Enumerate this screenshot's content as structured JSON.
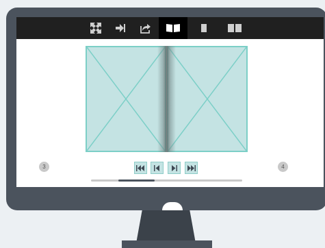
{
  "toolbar": {
    "buttons": [
      {
        "id": "fullscreen",
        "icon": "fullscreen-icon",
        "active": false
      },
      {
        "id": "goto",
        "icon": "goto-page-icon",
        "active": false
      },
      {
        "id": "share",
        "icon": "share-icon",
        "active": false
      },
      {
        "id": "book-view",
        "icon": "open-book-icon",
        "active": true
      },
      {
        "id": "single-page",
        "icon": "single-page-icon",
        "active": false
      },
      {
        "id": "double-page",
        "icon": "double-page-icon",
        "active": false
      }
    ]
  },
  "viewer": {
    "left_page_number": "3",
    "right_page_number": "4",
    "progress_fraction": 0.24
  },
  "navigation": {
    "controls": [
      "first-page",
      "previous-page",
      "next-page",
      "last-page"
    ]
  },
  "colors": {
    "bezel": "#4b535d",
    "toolbar": "#202020",
    "page_fill": "#c4e3e3",
    "page_border": "#7ccfc7"
  }
}
